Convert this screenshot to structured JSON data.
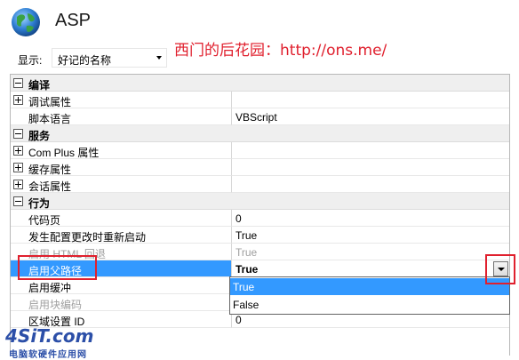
{
  "window": {
    "title": "ASP",
    "icon": "globe-icon"
  },
  "watermark": "西门的后花园：http://ons.me/",
  "filter": {
    "label": "显示:",
    "selected": "好记的名称"
  },
  "rows": [
    {
      "kind": "category",
      "name": "编译"
    },
    {
      "kind": "property",
      "name": "调试属性",
      "value": "",
      "expandable": true
    },
    {
      "kind": "property",
      "name": "脚本语言",
      "value": "VBScript"
    },
    {
      "kind": "category",
      "name": "服务"
    },
    {
      "kind": "property",
      "name": "Com Plus 属性",
      "value": "",
      "expandable": true
    },
    {
      "kind": "property",
      "name": "缓存属性",
      "value": "",
      "expandable": true
    },
    {
      "kind": "property",
      "name": "会话属性",
      "value": "",
      "expandable": true
    },
    {
      "kind": "category",
      "name": "行为"
    },
    {
      "kind": "property",
      "name": "代码页",
      "value": "0"
    },
    {
      "kind": "property",
      "name": "发生配置更改时重新启动",
      "value": "True"
    },
    {
      "kind": "property",
      "name": "启用 HTML 回退",
      "value": "True",
      "disabled": true
    },
    {
      "kind": "property",
      "name": "启用父路径",
      "value": "True",
      "selected": true
    },
    {
      "kind": "property",
      "name": "启用缓冲",
      "value": ""
    },
    {
      "kind": "property",
      "name": "启用块编码",
      "value": "",
      "disabled": true
    },
    {
      "kind": "property",
      "name": "区域设置 ID",
      "value": "0"
    }
  ],
  "dropdown": {
    "options": [
      "True",
      "False"
    ],
    "highlighted": "True"
  },
  "logo": {
    "big": "4SiT.com",
    "small": "电脑软硬件应用网"
  },
  "colors": {
    "accent": "#3399ff",
    "annotation": "#e0202e",
    "category_bg": "#efefef"
  }
}
